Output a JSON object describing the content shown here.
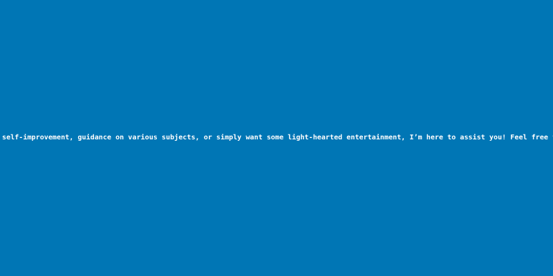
{
  "screen": {
    "background_color": "#0076b5",
    "text_color": "#ffffff",
    "message": "self-improvement, guidance on various subjects, or simply want some light-hearted entertainment, I’m here to assist you! Feel free to"
  }
}
